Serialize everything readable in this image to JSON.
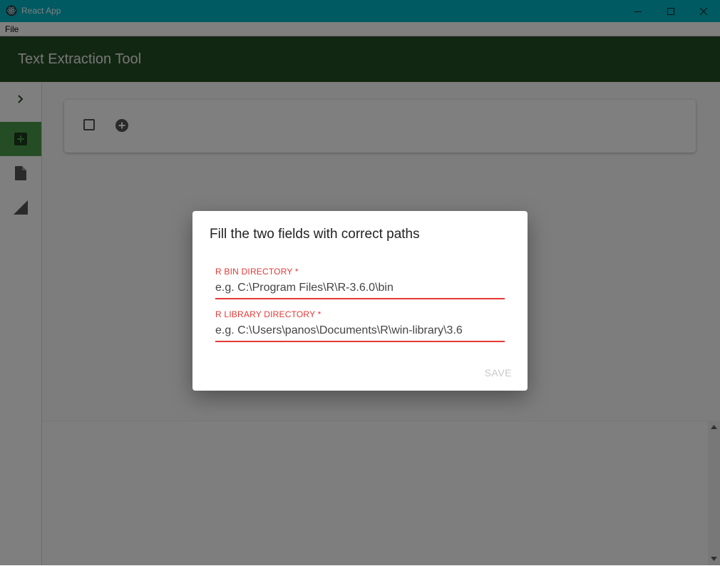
{
  "window": {
    "title": "React App",
    "controls": [
      "minimize-icon",
      "maximize-icon",
      "close-icon"
    ],
    "titlebar_color": "#00b4c4"
  },
  "menu": {
    "items": [
      "File"
    ]
  },
  "appbar": {
    "title": "Text Extraction Tool",
    "color": "#254e25"
  },
  "sidebar": {
    "items": [
      {
        "icon": "chevron-right-icon",
        "active": false
      },
      {
        "icon": "add-box-icon",
        "active": true
      },
      {
        "icon": "file-icon",
        "active": false
      },
      {
        "icon": "signal-triangle-icon",
        "active": false
      }
    ],
    "active_color": "#4b9b4b"
  },
  "toolbar": {
    "icons": [
      "checkbox-icon",
      "add-circle-icon"
    ]
  },
  "dialog": {
    "title": "Fill the two fields with correct paths",
    "fields": [
      {
        "label": "R BIN DIRECTORY *",
        "placeholder": "e.g. C:\\Program Files\\R\\R-3.6.0\\bin"
      },
      {
        "label": "R LIBRARY DIRECTORY *",
        "placeholder": "e.g. C:\\Users\\panos\\Documents\\R\\win-library\\3.6"
      }
    ],
    "save_label": "SAVE",
    "error_color": "#e53935"
  }
}
